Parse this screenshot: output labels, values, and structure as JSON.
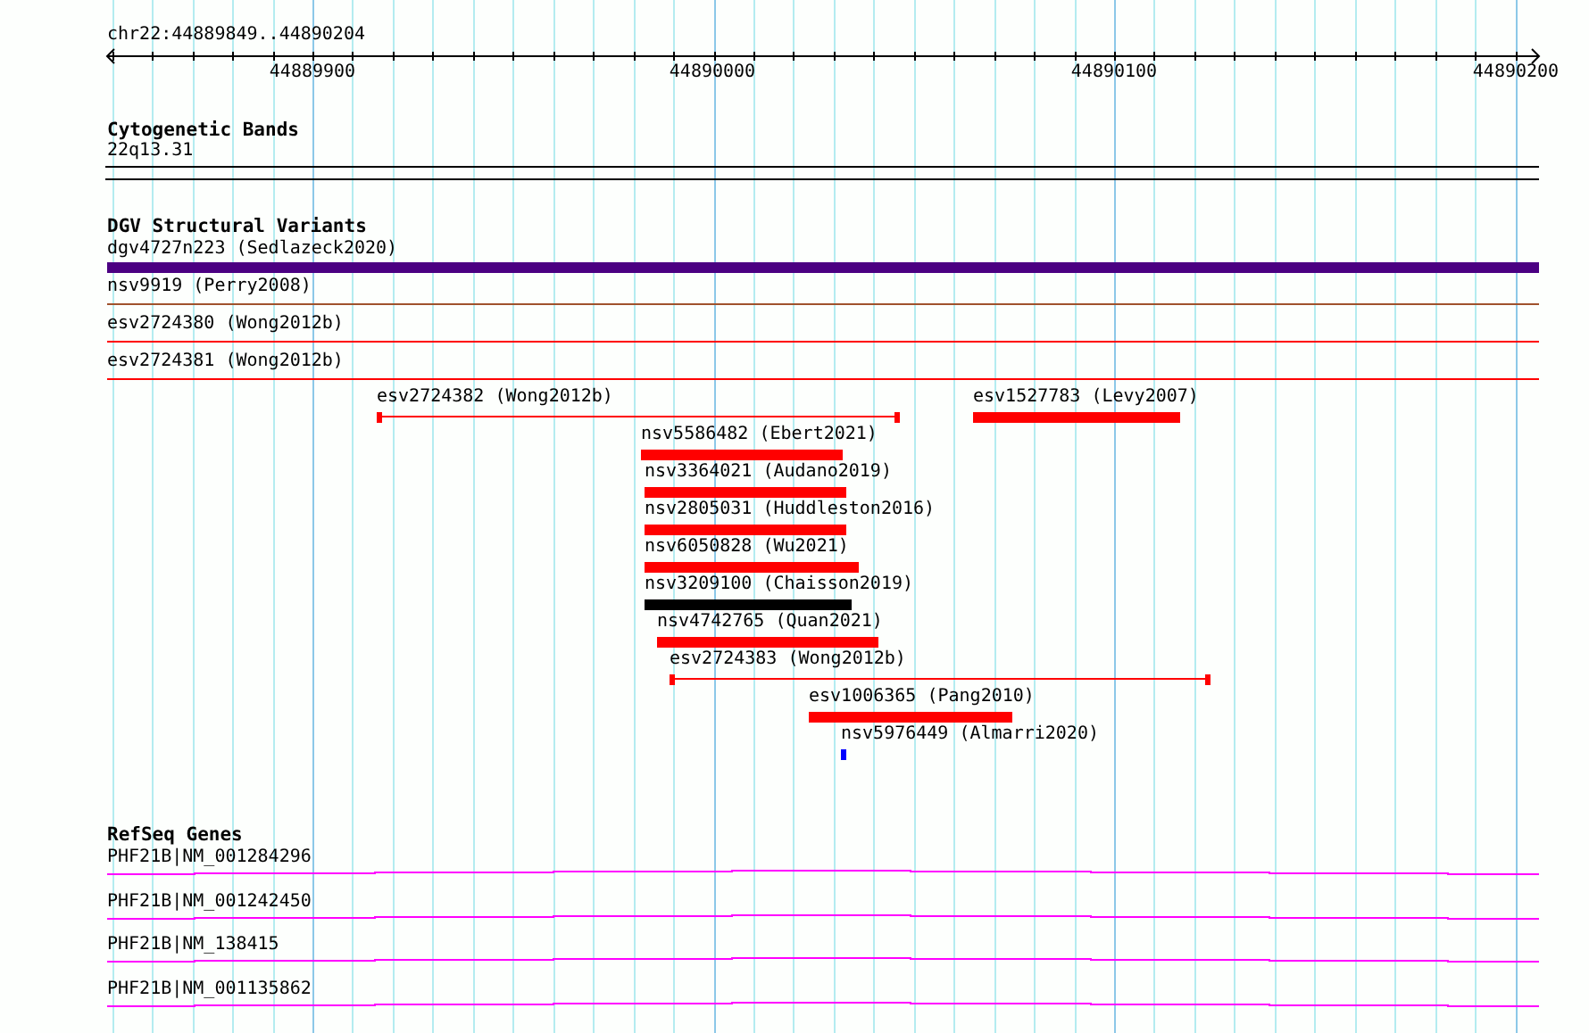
{
  "ruler": {
    "location": "chr22:44889849..44890204",
    "ticks": [
      "44889900",
      "44890000",
      "44890100",
      "44890200"
    ]
  },
  "tracks": [
    {
      "title": "Cytogenetic Bands",
      "kind": "bands",
      "features": [
        {
          "label": "22q13.31"
        }
      ]
    },
    {
      "title": "DGV Structural Variants",
      "kind": "variants",
      "features": [
        {
          "label": "dgv4727n223 (Sedlazeck2020)",
          "kind": "full-bar",
          "color": "#4b0082"
        },
        {
          "label": "nsv9919 (Perry2008)",
          "kind": "full-line",
          "color": "#a0522d"
        },
        {
          "label": "esv2724380 (Wong2012b)",
          "kind": "full-line",
          "color": "#ff0000"
        },
        {
          "label": "esv2724381 (Wong2012b)",
          "kind": "full-line",
          "color": "#ff0000"
        },
        {
          "label": "esv2724382 (Wong2012b)",
          "kind": "interval",
          "color": "#ff0000"
        },
        {
          "label": "esv1527783 (Levy2007)",
          "kind": "bar",
          "color": "#ff0000"
        },
        {
          "label": "nsv5586482 (Ebert2021)",
          "kind": "bar",
          "color": "#ff0000"
        },
        {
          "label": "nsv3364021 (Audano2019)",
          "kind": "bar",
          "color": "#ff0000"
        },
        {
          "label": "nsv2805031 (Huddleston2016)",
          "kind": "bar",
          "color": "#ff0000"
        },
        {
          "label": "nsv6050828 (Wu2021)",
          "kind": "bar",
          "color": "#ff0000"
        },
        {
          "label": "nsv3209100 (Chaisson2019)",
          "kind": "bar",
          "color": "#000000"
        },
        {
          "label": "nsv4742765 (Quan2021)",
          "kind": "bar",
          "color": "#ff0000"
        },
        {
          "label": "esv2724383 (Wong2012b)",
          "kind": "interval",
          "color": "#ff0000"
        },
        {
          "label": "esv1006365 (Pang2010)",
          "kind": "bar",
          "color": "#ff0000"
        },
        {
          "label": "nsv5976449 (Almarri2020)",
          "kind": "bar",
          "color": "#0000ff"
        }
      ]
    },
    {
      "title": "RefSeq Genes",
      "kind": "genes",
      "features": [
        {
          "label": "PHF21B|NM_001284296"
        },
        {
          "label": "PHF21B|NM_001242450"
        },
        {
          "label": "PHF21B|NM_138415"
        },
        {
          "label": "PHF21B|NM_001135862"
        }
      ]
    }
  ]
}
